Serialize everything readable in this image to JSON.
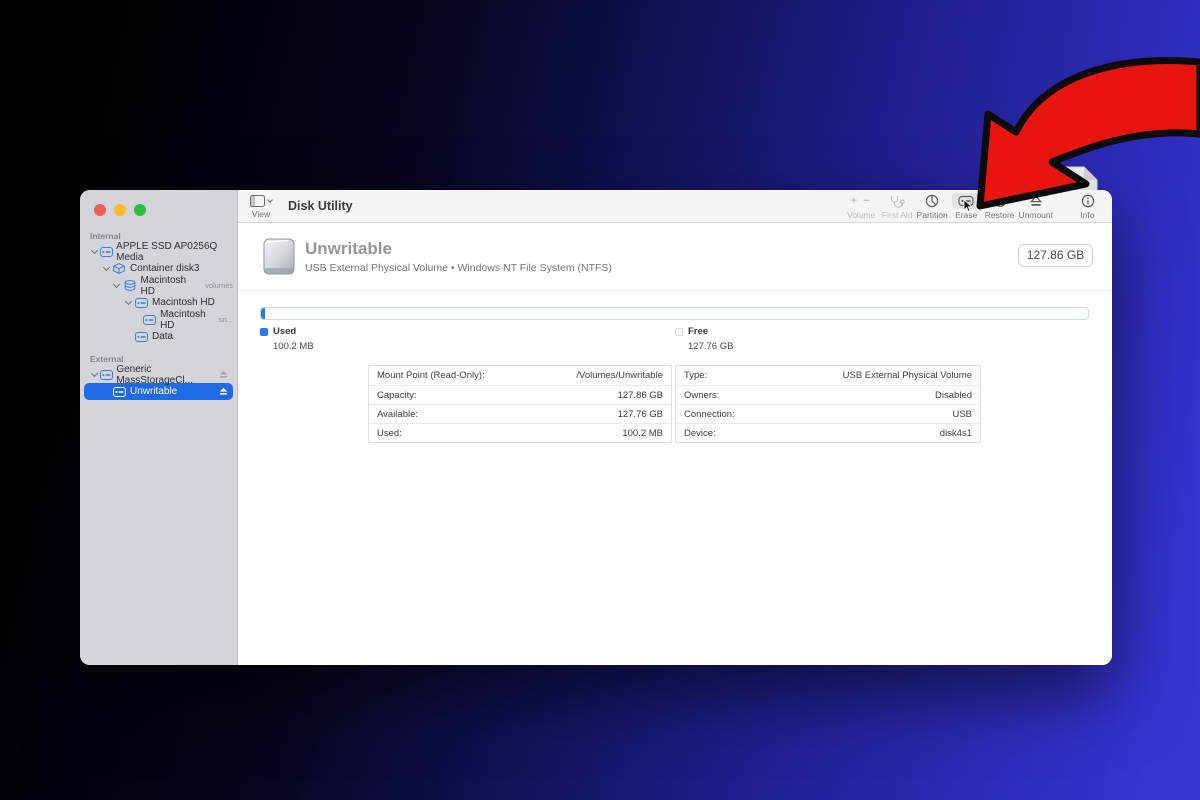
{
  "window": {
    "sidebar": {
      "sections": [
        {
          "title": "Internal",
          "items": [
            {
              "label": "APPLE SSD AP0256Q Media",
              "suffix": ""
            },
            {
              "label": "Container disk3",
              "suffix": ""
            },
            {
              "label": "Macintosh HD",
              "suffix": "volumes"
            },
            {
              "label": "Macintosh HD",
              "suffix": ""
            },
            {
              "label": "Macintosh HD",
              "suffix": "sn..."
            },
            {
              "label": "Data",
              "suffix": ""
            }
          ]
        },
        {
          "title": "External",
          "items": [
            {
              "label": "Generic MassStorageCl...",
              "suffix": ""
            },
            {
              "label": "Unwritable",
              "suffix": ""
            }
          ]
        }
      ]
    },
    "toolbar": {
      "view_label": "View",
      "app_title": "Disk Utility",
      "buttons": [
        {
          "label": "Volume"
        },
        {
          "label": "First Aid"
        },
        {
          "label": "Partition"
        },
        {
          "label": "Erase"
        },
        {
          "label": "Restore"
        },
        {
          "label": "Unmount"
        },
        {
          "label": "Info"
        }
      ]
    },
    "content": {
      "volume_title": "Unwritable",
      "volume_subtitle": "USB External Physical Volume • Windows NT File System (NTFS)",
      "capacity_badge": "127.86 GB",
      "usage": {
        "used_label": "Used",
        "used_value": "100.2 MB",
        "free_label": "Free",
        "free_value": "127.76 GB",
        "used_color": "#2979e0"
      },
      "details_left": [
        {
          "label": "Mount Point (Read-Only):",
          "value": "/Volumes/Unwritable"
        },
        {
          "label": "Capacity:",
          "value": "127.86 GB"
        },
        {
          "label": "Available:",
          "value": "127.76 GB"
        },
        {
          "label": "Used:",
          "value": "100.2 MB"
        }
      ],
      "details_right": [
        {
          "label": "Type:",
          "value": "USB External Physical Volume"
        },
        {
          "label": "Owners:",
          "value": "Disabled"
        },
        {
          "label": "Connection:",
          "value": "USB"
        },
        {
          "label": "Device:",
          "value": "disk4s1"
        }
      ]
    }
  },
  "annotation": {
    "arrow_color": "#e8140e"
  }
}
